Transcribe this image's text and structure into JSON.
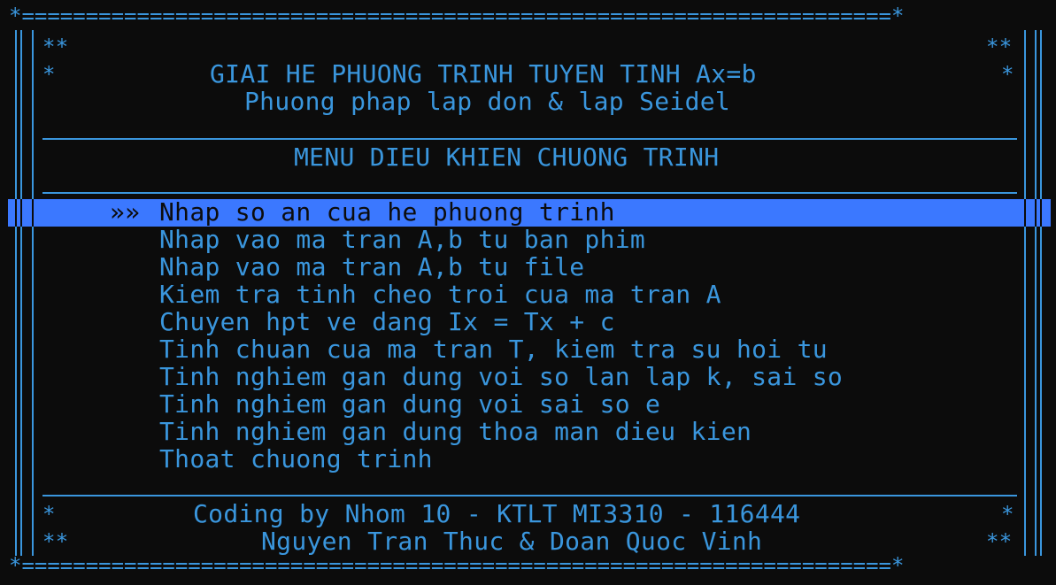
{
  "colors": {
    "background": "#0c0c0c",
    "text": "#3a96dd",
    "highlight_bg": "#3b78ff",
    "highlight_fg": "#0c0c0c"
  },
  "frame": {
    "top_border": "*====================================================================*",
    "bottom_border": "*====================================================================*",
    "double_star": "**",
    "single_star": "*"
  },
  "header": {
    "title": "GIAI HE PHUONG TRINH TUYEN TINH Ax=b",
    "subtitle": "Phuong phap lap don & lap Seidel"
  },
  "menu": {
    "heading": "MENU DIEU KHIEN CHUONG TRINH",
    "cursor": "»»",
    "selected_index": 0,
    "items": [
      "Nhap so an cua he phuong trinh",
      "Nhap vao ma tran A,b tu ban phim",
      "Nhap vao ma tran A,b tu file",
      "Kiem tra tinh cheo troi cua ma tran A",
      "Chuyen hpt ve dang Ix = Tx + c",
      "Tinh chuan cua ma tran T, kiem tra su hoi tu",
      "Tinh nghiem gan dung voi so lan lap k, sai so",
      "Tinh nghiem gan dung voi sai so e",
      "Tinh nghiem gan dung thoa man dieu kien",
      "Thoat chuong trinh"
    ]
  },
  "footer": {
    "credit": "Coding by Nhom 10 - KTLT MI3310 - 116444",
    "authors": "Nguyen Tran Thuc & Doan Quoc Vinh"
  }
}
